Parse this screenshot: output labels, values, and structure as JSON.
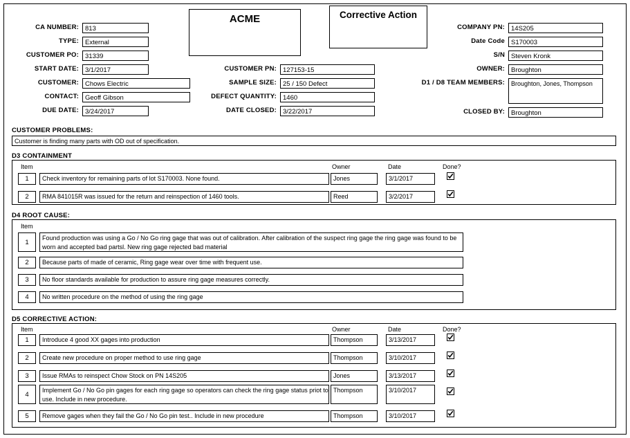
{
  "form": {
    "logo_title": "ACME",
    "doc_title": "Corrective Action"
  },
  "header": {
    "left": [
      {
        "label": "CA NUMBER:",
        "value": "813"
      },
      {
        "label": "TYPE:",
        "value": "External"
      },
      {
        "label": "CUSTOMER PO:",
        "value": "31339"
      },
      {
        "label": "START DATE:",
        "value": "3/1/2017"
      },
      {
        "label": "CUSTOMER:",
        "value": "Chows Electric"
      },
      {
        "label": "CONTACT:",
        "value": "Geoff Gibson"
      },
      {
        "label": "DUE DATE:",
        "value": "3/24/2017"
      }
    ],
    "middle": [
      {
        "label": "CUSTOMER PN:",
        "value": "127153-15"
      },
      {
        "label": "SAMPLE SIZE:",
        "value": "25 / 150 Defect"
      },
      {
        "label": "DEFECT QUANTITY:",
        "value": "1460"
      },
      {
        "label": "DATE CLOSED:",
        "value": "3/22/2017"
      }
    ],
    "right": [
      {
        "label": "COMPANY PN:",
        "value": "14S205"
      },
      {
        "label": "Date Code",
        "value": "S170003"
      },
      {
        "label": "S/N",
        "value": "Steven Kronk"
      },
      {
        "label": "OWNER:",
        "value": "Broughton"
      },
      {
        "label": "D1 / D8 TEAM MEMBERS:",
        "value": "Broughton, Jones, Thompson"
      },
      {
        "label": "CLOSED BY:",
        "value": "Broughton"
      }
    ]
  },
  "customer_problems": {
    "title": "CUSTOMER PROBLEMS:",
    "text": "Customer is finding many parts with OD out of specification."
  },
  "d3": {
    "title": "D3 CONTAINMENT",
    "columns": {
      "item": "Item",
      "owner": "Owner",
      "date": "Date",
      "done": "Done?"
    },
    "rows": [
      {
        "item": "1",
        "text": "Check inventory for remaining parts of lot S170003. None found.",
        "owner": "Jones",
        "date": "3/1/2017",
        "done": true
      },
      {
        "item": "2",
        "text": "RMA 841015R was issued for the return and reinspection of 1460 tools.",
        "owner": "Reed",
        "date": "3/2/2017",
        "done": true
      }
    ]
  },
  "d4": {
    "title": "D4  ROOT CAUSE:",
    "columns": {
      "item": "Item"
    },
    "rows": [
      {
        "item": "1",
        "text": "Found production was using a  Go / No Go ring gage that was out of calibration. After calibration of the suspect ring gage the ring gage was found to be worn and accepted bad partsl. New ring gage rejected bad material"
      },
      {
        "item": "2",
        "text": "Because parts of made of ceramic, Ring gage wear over time with frequent use."
      },
      {
        "item": "3",
        "text": "No floor standards available for production to assure ring gage measures correctly."
      },
      {
        "item": "4",
        "text": "No written procedure on the method of using the ring gage"
      }
    ]
  },
  "d5": {
    "title": "D5  CORRECTIVE ACTION:",
    "columns": {
      "item": "Item",
      "owner": "Owner",
      "date": "Date",
      "done": "Done?"
    },
    "rows": [
      {
        "item": "1",
        "text": "Introduce 4 good XX gages into production",
        "owner": "Thompson",
        "date": "3/13/2017",
        "done": true
      },
      {
        "item": "2",
        "text": "Create new procedure on proper method to use ring gage",
        "owner": "Thompson",
        "date": "3/10/2017",
        "done": true
      },
      {
        "item": "3",
        "text": "Issue RMAs to reinspect Chow Stock on PN 14S205",
        "owner": "Jones",
        "date": "3/13/2017",
        "done": true
      },
      {
        "item": "4",
        "text": "Implement Go / No Go pin gages for each ring gage so operators can check the ring gage status priot to use. Include in new procedure.",
        "owner": "Thompson",
        "date": "3/10/2017",
        "done": true
      },
      {
        "item": "5",
        "text": "Remove gages when they fail the Go / No Go pin test.. Include in new procedure",
        "owner": "Thompson",
        "date": "3/10/2017",
        "done": true
      }
    ]
  }
}
